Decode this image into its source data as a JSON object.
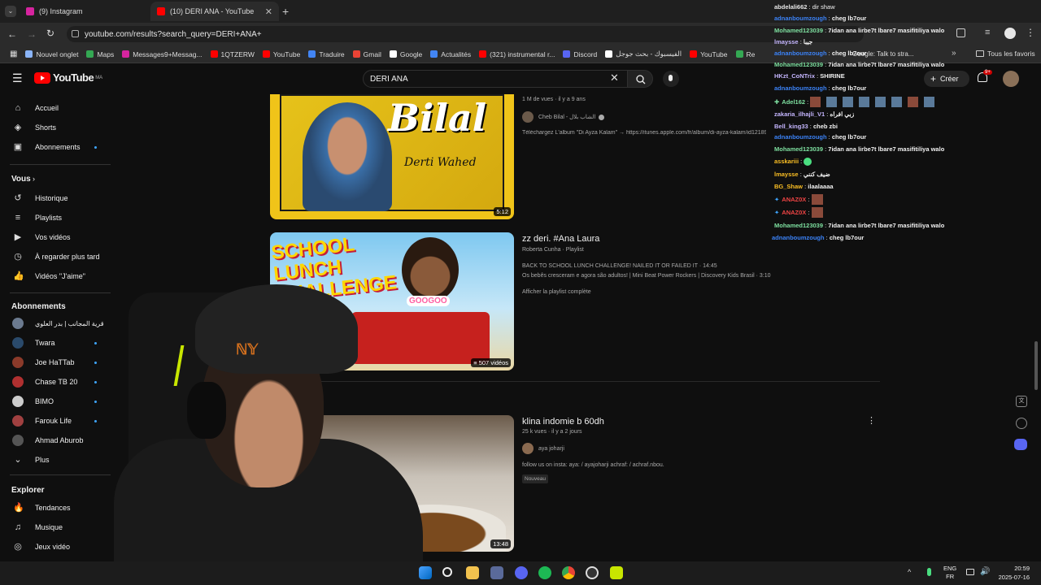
{
  "browser": {
    "tabs": [
      {
        "title": "(9) Instagram",
        "active": false,
        "color": "#d6249f"
      },
      {
        "title": "(10) DERI ANA - YouTube",
        "active": true,
        "color": "#ff0000"
      }
    ],
    "new_tab_symbol": "+",
    "close_symbol": "✕",
    "url": "youtube.com/results?search_query=DERI+ANA+",
    "bookmarks": [
      {
        "label": "Nouvel onglet",
        "icon": "globe-icon",
        "color": "#8ab4f8"
      },
      {
        "label": "Maps",
        "icon": "maps-icon",
        "color": "#34a853"
      },
      {
        "label": "Messages9+Messag...",
        "icon": "instagram-icon",
        "color": "#d6249f"
      },
      {
        "label": "1QTZERW",
        "icon": "youtube-icon",
        "color": "#ff0000"
      },
      {
        "label": "YouTube",
        "icon": "youtube-icon",
        "color": "#ff0000"
      },
      {
        "label": "Traduire",
        "icon": "translate-icon",
        "color": "#4285f4"
      },
      {
        "label": "Gmail",
        "icon": "gmail-icon",
        "color": "#ea4335"
      },
      {
        "label": "Google",
        "icon": "google-icon",
        "color": "#ffffff"
      },
      {
        "label": "Actualités",
        "icon": "news-icon",
        "color": "#4285f4"
      },
      {
        "label": "(321) instrumental r...",
        "icon": "youtube-icon",
        "color": "#ff0000"
      },
      {
        "label": "Discord",
        "icon": "discord-icon",
        "color": "#5865f2"
      },
      {
        "label": "الفيسبوك - بحث جوجل",
        "icon": "google-icon",
        "color": "#ffffff"
      },
      {
        "label": "YouTube",
        "icon": "youtube-icon",
        "color": "#ff0000"
      },
      {
        "label": "Re",
        "icon": "app-icon",
        "color": "#34a853"
      }
    ],
    "bookmarks_extra": "Google: Talk to stra...",
    "all_favorites": "Tous les favoris"
  },
  "youtube": {
    "logo": "YouTube",
    "region": "MA",
    "search_value": "DERI ANA",
    "create_label": "Créer",
    "notif_count": "9+",
    "sidebar": {
      "main": [
        {
          "label": "Accueil",
          "icon": "home-icon"
        },
        {
          "label": "Shorts",
          "icon": "shorts-icon"
        },
        {
          "label": "Abonnements",
          "icon": "subscriptions-icon",
          "dot": true
        }
      ],
      "you_header": "Vous",
      "you": [
        {
          "label": "Historique",
          "icon": "history-icon"
        },
        {
          "label": "Playlists",
          "icon": "playlists-icon"
        },
        {
          "label": "Vos vidéos",
          "icon": "your-videos-icon"
        },
        {
          "label": "À regarder plus tard",
          "icon": "watch-later-icon"
        },
        {
          "label": "Vidéos \"J'aime\"",
          "icon": "like-icon"
        }
      ],
      "subs_header": "Abonnements",
      "subs": [
        {
          "label": "قرية المجانب | بدر العلوي",
          "color": "#6b7a8f",
          "dot": false
        },
        {
          "label": "Twara",
          "color": "#2a4a6b",
          "dot": true
        },
        {
          "label": "Joe HaTTab",
          "color": "#8b3a2a",
          "dot": true
        },
        {
          "label": "Chase TB 20",
          "color": "#b03030",
          "dot": true
        },
        {
          "label": "BIMO",
          "color": "#cccccc",
          "dot": true
        },
        {
          "label": "Farouk Life",
          "color": "#a04040",
          "dot": true
        },
        {
          "label": "Ahmad Aburob",
          "color": "#555555",
          "dot": false
        }
      ],
      "more": "Plus",
      "explore_header": "Explorer",
      "explore": [
        {
          "label": "Tendances",
          "icon": "trending-icon"
        },
        {
          "label": "Musique",
          "icon": "music-icon"
        },
        {
          "label": "Jeux vidéo",
          "icon": "gaming-icon"
        }
      ]
    },
    "results": [
      {
        "thumb_title": "Bilal",
        "thumb_sub": "Derti Wahed",
        "duration": "5:12",
        "meta": "1 M de vues · il y a 9 ans",
        "channel": "Cheb Bilal - الشاب بلال",
        "desc": "Téléchargez L'album \"Di Ayza Kalam\" → https://itunes.apple.com/fr/album/di-ayza-kalam/id1218991197 ♫ Abonnez-vous à la"
      },
      {
        "title": "zz deri. #Ana Laura",
        "thumb_text": "SCHOOL LUNCH CHALLENGE",
        "thumb_badge": "GOOGOO",
        "video_count": "507 vidéos",
        "meta": "Roberta Cunha · Playlist",
        "lines": [
          "BACK TO SCHOOL LUNCH CHALLENGE! NAILED IT OR FAILED IT · 14:45",
          "Os bebês cresceram e agora são adultos! | Mini Beat Power Rockers | Discovery Kids Brasil · 3:10"
        ],
        "link": "Afficher la playlist complète"
      },
      {
        "title": "klina indomie b 60dh",
        "duration": "13:48",
        "meta": "25 k vues · il y a 2 jours",
        "channel": "aya joharji",
        "desc": "follow us on insta: aya: / ayajoharji achraf: / achraf.nbou.",
        "badge": "Nouveau"
      }
    ]
  },
  "chat": [
    {
      "user": "abdelali662",
      "msg": "dir shaw",
      "color": "#e6e6e6"
    },
    {
      "user": "adnanboumzough",
      "msg": "cheg lb7our",
      "color": "#3b82f6"
    },
    {
      "user": "Mohamed123039",
      "msg": "7idan ana lirbe7t lbare7 masifitiliya walo",
      "color": "#7ee0a0"
    },
    {
      "user": "lmaysse",
      "msg": "جيبا",
      "color": "#c4b5fd"
    },
    {
      "user": "adnanboumzough",
      "msg": "cheg lb7our",
      "color": "#3b82f6"
    },
    {
      "user": "Mohamed123039",
      "msg": "7idan ana lirbe7t lbare7 masifitiliya walo",
      "color": "#7ee0a0"
    },
    {
      "user": "HKzt_CoNTrix",
      "msg": "SHIRINE",
      "color": "#c4b5fd"
    },
    {
      "user": "adnanboumzough",
      "msg": "cheg lb7our",
      "color": "#3b82f6"
    },
    {
      "user": "Adel162",
      "msg": "",
      "color": "#7ee0a0"
    },
    {
      "user": "zakaria_ilhajli_V1",
      "msg": "زبي افراه",
      "color": "#c4b5fd"
    },
    {
      "user": "Bell_king33",
      "msg": "cheb zbi",
      "color": "#c4b5fd"
    },
    {
      "user": "adnanboumzough",
      "msg": "cheg lb7our",
      "color": "#3b82f6"
    },
    {
      "user": "Mohamed123039",
      "msg": "7idan ana lirbe7t lbare7 masifitiliya walo",
      "color": "#7ee0a0"
    },
    {
      "user": "asskariii",
      "msg": "",
      "color": "#fbbf24"
    },
    {
      "user": "lmaysse",
      "msg": "ضيف كنني",
      "color": "#fbbf24"
    },
    {
      "user": "BG_Shaw",
      "msg": "ilaalaaaa",
      "color": "#fbbf24"
    },
    {
      "user": "ANAZ0X",
      "msg": "",
      "color": "#ef4444"
    },
    {
      "user": "ANAZ0X",
      "msg": "",
      "color": "#ef4444"
    },
    {
      "user": "Mohamed123039",
      "msg": "7idan ana lirbe7t lbare7 masifitiliya walo",
      "color": "#7ee0a0"
    },
    {
      "user": "adnanboumzough",
      "msg": "cheg lb7our",
      "color": "#3b82f6"
    }
  ],
  "taskbar": {
    "lang_top": "ENG",
    "lang_bottom": "FR",
    "time": "20:59",
    "date": "2025-07-16"
  }
}
